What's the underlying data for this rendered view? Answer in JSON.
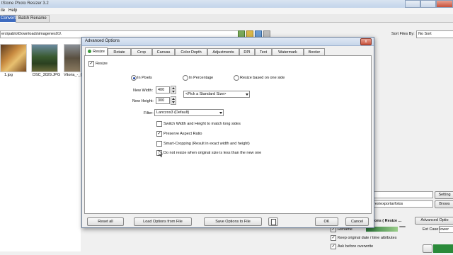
{
  "app": {
    "title": "tStone Photo Resizer 3.2",
    "menu": [
      "ile",
      "Help"
    ],
    "tabs": [
      "Convert",
      "Batch Rename"
    ],
    "path": "ers\\pablo\\Downloads\\imagenes01\\",
    "thumbs": [
      "1.jpg",
      "DSC_3029.JPG",
      "Vitoria_-_("
    ],
    "sort_label": "Sort Files By:",
    "sort_value": "No Sort",
    "output_path": "res\\exportarfotos",
    "browse": "Brows",
    "setting": "Setting",
    "adv_label": "ons ( Resize ...",
    "adv_button": "Advanced Optio",
    "rename": "Rename",
    "keep_date": "Keep original date / time attributes",
    "ask_overwrite": "Ask before overwrite",
    "ext_case": "Ext Case:",
    "ext_value": "lower"
  },
  "dialog": {
    "title": "Advanced Options",
    "close": "x",
    "tabs": [
      "Resize",
      "Rotate",
      "Crop",
      "Canvas",
      "Color Depth",
      "Adjustments",
      "DPI",
      "Text",
      "Watermark",
      "Border"
    ],
    "resize_check": "Resize",
    "modes": [
      "In Pixels",
      "In Percentage",
      "Resize based on one side"
    ],
    "new_width_label": "New Width:",
    "new_width": "400",
    "new_height_label": "New Height:",
    "new_height": "300",
    "standard_size": "<Pick a Standard Size>",
    "filter_label": "Filter:",
    "filter_value": "Lanczos3 (Default)",
    "options": [
      "Switch Width and Height to match long sides",
      "Preserve Aspect Ratio",
      "Smart-Cropping (Result in exact width and height)",
      "Do not resize when original size is less than the new one"
    ],
    "options_checked": [
      false,
      true,
      false,
      false
    ],
    "buttons": {
      "reset": "Reset all",
      "load": "Load Options from File",
      "save": "Save Options to File",
      "ok": "OK",
      "cancel": "Cancel"
    }
  }
}
